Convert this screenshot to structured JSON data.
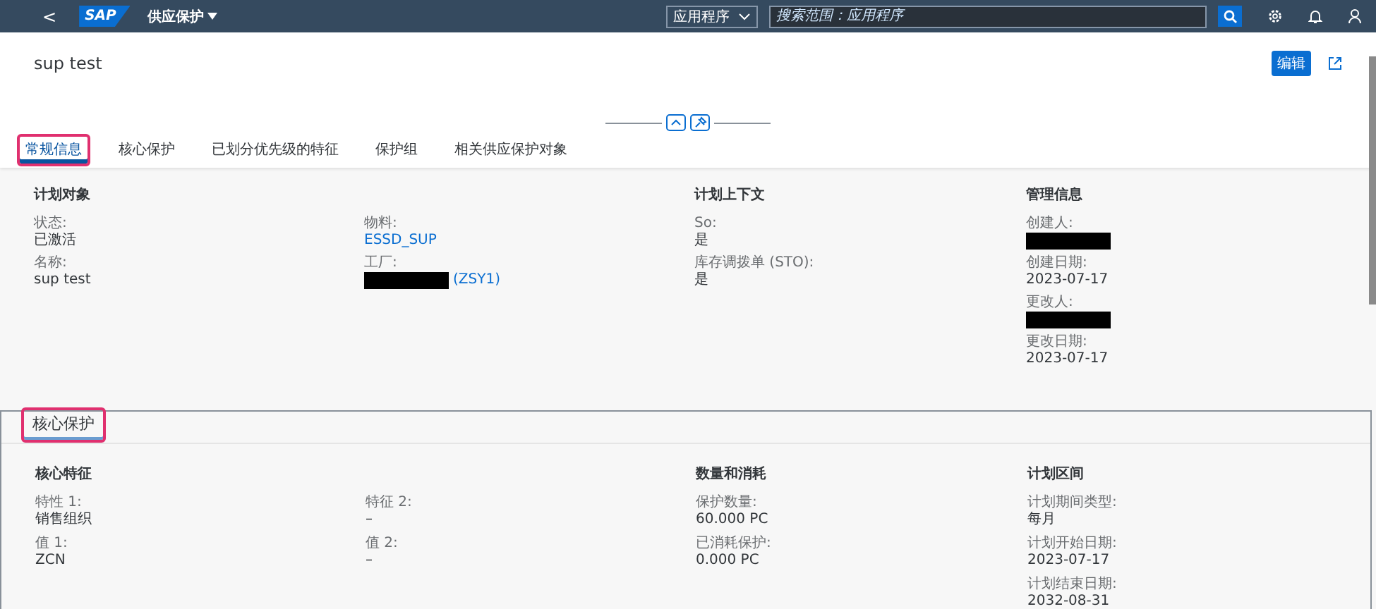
{
  "shell": {
    "back": "<",
    "logo": "SAP",
    "app_title": "供应保护",
    "scope": "应用程序",
    "search": {
      "placeholder": "搜索范围：应用程序"
    }
  },
  "object": {
    "title": "sup test",
    "edit_button": "编辑"
  },
  "tabs": [
    {
      "label": "常规信息",
      "selected": true,
      "highlighted": true
    },
    {
      "label": "核心保护",
      "selected": false,
      "highlighted": false
    },
    {
      "label": "已划分优先级的特征",
      "selected": false,
      "highlighted": false
    },
    {
      "label": "保护组",
      "selected": false,
      "highlighted": false
    },
    {
      "label": "相关供应保护对象",
      "selected": false,
      "highlighted": false
    }
  ],
  "general": {
    "groups": [
      {
        "title": "计划对象",
        "fields": [
          {
            "label": "状态:",
            "value": "已激活"
          },
          {
            "label": "名称:",
            "value": "sup test"
          }
        ]
      },
      {
        "fields": [
          {
            "label": "物料:",
            "value": "ESSD_SUP",
            "kind": "link"
          },
          {
            "label": "工厂:",
            "value": "(ZSY1)",
            "kind": "link",
            "redacted": true
          }
        ]
      },
      {
        "title": "计划上下文",
        "fields": [
          {
            "label": "So:",
            "value": "是"
          },
          {
            "label": "库存调拨单 (STO):",
            "value": "是"
          }
        ]
      },
      {
        "title": "管理信息",
        "fields": [
          {
            "label": "创建人:",
            "redacted": true
          },
          {
            "label": "创建日期:",
            "value": "2023-07-17"
          },
          {
            "label": "更改人:",
            "redacted": true
          },
          {
            "label": "更改日期:",
            "value": "2023-07-17"
          }
        ]
      }
    ]
  },
  "core": {
    "title": "核心保护",
    "highlighted": true,
    "groups": [
      {
        "title": "核心特征",
        "fields": [
          {
            "label": "特性 1:",
            "value": "销售组织"
          },
          {
            "label": "值 1:",
            "value": "ZCN"
          }
        ]
      },
      {
        "fields": [
          {
            "label": "特征 2:",
            "value": "–"
          },
          {
            "label": "值 2:",
            "value": "–"
          }
        ]
      },
      {
        "title": "数量和消耗",
        "fields": [
          {
            "label": "保护数量:",
            "value": "60.000 PC"
          },
          {
            "label": "已消耗保护:",
            "value": "0.000 PC"
          }
        ]
      },
      {
        "title": "计划区间",
        "fields": [
          {
            "label": "计划期间类型:",
            "value": "每月"
          },
          {
            "label": "计划开始日期:",
            "value": "2023-07-17"
          },
          {
            "label": "计划结束日期:",
            "value": "2032-08-31"
          }
        ]
      }
    ]
  }
}
